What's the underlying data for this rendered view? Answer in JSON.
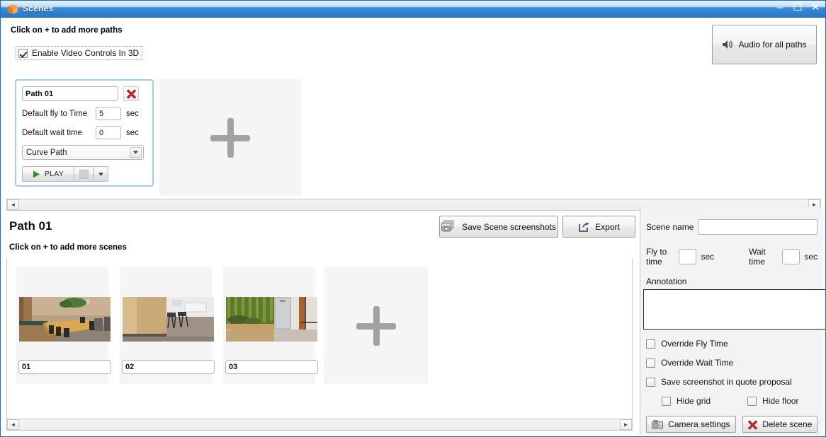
{
  "window": {
    "title": "Scenes",
    "app_icon": "cube-icon",
    "controls": {
      "minimize": "–",
      "maximize": "☐",
      "close": "✕"
    },
    "accent_color": "#2b7ac5"
  },
  "header": {
    "hint": "Click on + to add more paths",
    "enable_video_controls": {
      "label": "Enable Video Controls In 3D",
      "checked": true
    },
    "audio_button": {
      "label": "Audio for all paths",
      "icon": "speaker-icon"
    }
  },
  "paths_strip": {
    "add_path_tile": {
      "glyph": "+",
      "icon": "plus-icon"
    },
    "scrollbar": {
      "left_arrow": "◄",
      "right_arrow": "►"
    },
    "path_card": {
      "name": "Path 01",
      "delete_icon": "red-x-icon",
      "fly_to_time": {
        "label": "Default fly to Time",
        "value": "5",
        "unit": "sec"
      },
      "wait_time": {
        "label": "Default wait time",
        "value": "0",
        "unit": "sec"
      },
      "path_type": {
        "selected": "Curve Path",
        "arrow": "▼"
      },
      "transport": {
        "play_label": "PLAY",
        "play_icon": "play-triangle-icon",
        "stop_icon": "stop-square-icon",
        "dropdown_arrow": "▼"
      }
    }
  },
  "path_detail": {
    "title": "Path 01",
    "hint": "Click on + to add more scenes",
    "save_screenshots_button": {
      "label": "Save Scene screenshots",
      "icon": "camera-stack-icon"
    },
    "export_button": {
      "label": "Export",
      "icon": "export-arrow-icon"
    }
  },
  "scenes": {
    "items": [
      {
        "name": "01",
        "thumb_alt": "conference-room-thumbnail"
      },
      {
        "name": "02",
        "thumb_alt": "office-interior-thumbnail"
      },
      {
        "name": "03",
        "thumb_alt": "green-wall-corridor-thumbnail"
      }
    ],
    "add_scene_tile": {
      "glyph": "+",
      "icon": "plus-icon"
    },
    "scrollbar": {
      "left_arrow": "◄",
      "right_arrow": "►"
    }
  },
  "scene_properties": {
    "scene_name": {
      "label": "Scene name",
      "value": "",
      "placeholder": ""
    },
    "fly_to_time": {
      "label": "Fly to time",
      "value": "",
      "unit": "sec"
    },
    "wait_time": {
      "label": "Wait time",
      "value": "",
      "unit": "sec"
    },
    "annotation": {
      "label": "Annotation",
      "value": ""
    },
    "checkboxes": [
      {
        "label": "Override Fly Time",
        "checked": false
      },
      {
        "label": "Override Wait Time",
        "checked": false
      },
      {
        "label": "Save screenshot in quote proposal",
        "checked": false
      },
      {
        "label": "Hide grid",
        "checked": false
      },
      {
        "label": "Hide floor",
        "checked": false
      }
    ],
    "camera_settings_button": {
      "label": "Camera settings",
      "icon": "camera-icon"
    },
    "delete_scene_button": {
      "label": "Delete scene",
      "icon": "red-x-icon"
    }
  }
}
